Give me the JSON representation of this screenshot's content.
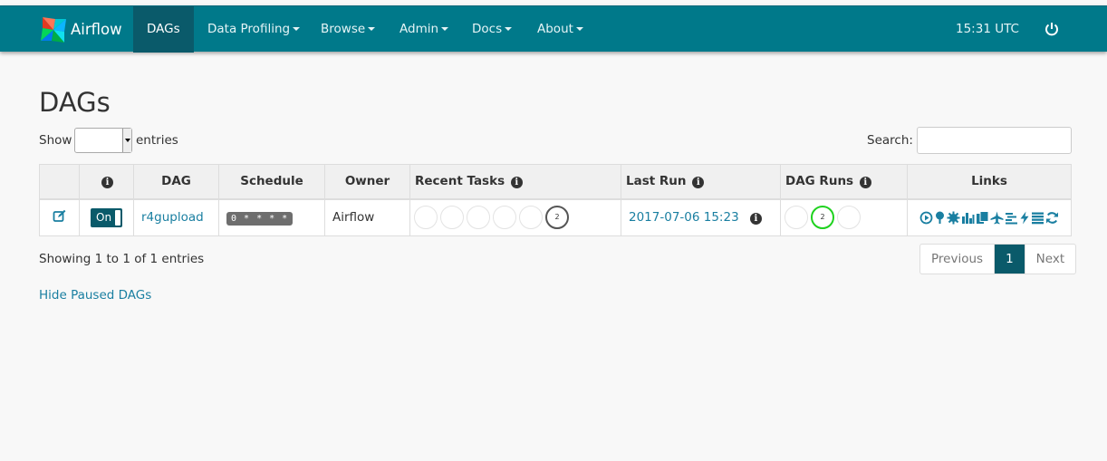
{
  "nav": {
    "brand": "Airflow",
    "items": [
      {
        "label": "DAGs",
        "active": true
      },
      {
        "label": "Data Profiling",
        "dropdown": true
      },
      {
        "label": "Browse",
        "dropdown": true
      },
      {
        "label": "Admin",
        "dropdown": true
      },
      {
        "label": "Docs",
        "dropdown": true
      },
      {
        "label": "About",
        "dropdown": true
      }
    ],
    "time": "15:31 UTC",
    "power_icon": "power-icon"
  },
  "page": {
    "title": "DAGs",
    "show_label": "Show",
    "entries_label": "entries",
    "search_label": "Search:",
    "search_value": ""
  },
  "table": {
    "headers": {
      "info": "i",
      "dag": "DAG",
      "schedule": "Schedule",
      "owner": "Owner",
      "recent_tasks": "Recent Tasks",
      "last_run": "Last Run",
      "dag_runs": "DAG Runs",
      "links": "Links"
    },
    "rows": [
      {
        "toggle": "On",
        "dag": "r4gupload",
        "schedule": "0 * * * *",
        "owner": "Airflow",
        "recent_tasks": [
          "",
          "",
          "",
          "",
          "",
          "2"
        ],
        "last_run": "2017-07-06 15:23",
        "dag_runs": [
          "",
          "2",
          ""
        ]
      }
    ]
  },
  "footer": {
    "showing": "Showing 1 to 1 of 1 entries",
    "previous": "Previous",
    "page": "1",
    "next": "Next",
    "hide_paused": "Hide Paused DAGs"
  },
  "colors": {
    "navbar": "#00798a",
    "active_nav": "#0a5a6a",
    "link": "#1a7fa1",
    "success": "#1ed21e"
  }
}
